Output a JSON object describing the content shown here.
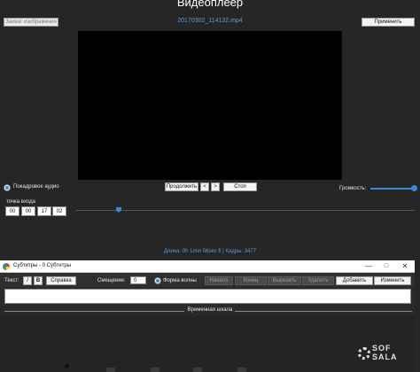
{
  "player": {
    "title": "Видеоплеер",
    "capture_button": "Захват изображения",
    "apply_button": "Применить",
    "filename": "20170302_114132.mp4",
    "audio_radio_label": "Покадровое аудио",
    "continue_button": "Продолжить",
    "prev_button": "<",
    "next_button": ">",
    "stop_button": "Стоп",
    "volume_label": "Громкость:",
    "volume_level": 1.0,
    "entry_point_label": "точка входа",
    "entry_time": {
      "hours": "00",
      "minutes": "00",
      "seconds": "17",
      "frames": "02"
    },
    "seek_position": 0.13,
    "duration_text": "Длина: 0h 1min 56sec fi | Кадры: 3477"
  },
  "subtitles": {
    "window_title": "Субтитры - 0 Субтитры",
    "text_label": "Текст:",
    "italic_button": "I",
    "bold_button": "B",
    "help_button": "Справка",
    "offset_label": "Смещение:",
    "offset_value": "0",
    "waveform_label": "Форма волны",
    "start_button": "Начало",
    "end_button": "Конец",
    "cut_button": "Вырезать",
    "delete_button": "Удалить",
    "add_button": "Добавить",
    "edit_button": "Изменить",
    "timeline_label": "Временная шкала"
  },
  "watermark": {
    "line1": "SOF",
    "line2": "SALA"
  },
  "colors": {
    "accent": "#3b88d6",
    "link_text": "#5b9bd5",
    "background": "#262626"
  }
}
